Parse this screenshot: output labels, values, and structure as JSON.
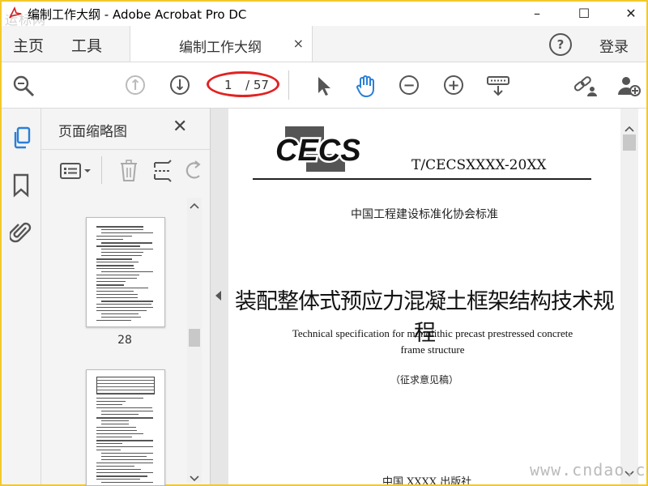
{
  "window": {
    "title": "编制工作大纲 - Adobe Acrobat Pro DC",
    "watermark": "运标网",
    "min_label": "–",
    "max_label": "☐",
    "close_label": "✕"
  },
  "menubar": {
    "home": "主页",
    "tools": "工具",
    "doc_tab": "编制工作大纲",
    "tab_close": "×",
    "help": "?",
    "login": "登录"
  },
  "toolbar": {
    "page_current": "1",
    "page_total": "/ 57",
    "prev_page_symbol": "↑",
    "next_page_symbol": "↓",
    "zoom_out_symbol": "−",
    "zoom_in_symbol": "+"
  },
  "panel": {
    "title": "页面缩略图",
    "close": "✕",
    "thumbnails": [
      {
        "page_label": "28"
      },
      {
        "page_label": ""
      }
    ]
  },
  "document": {
    "logo_text": "CECS",
    "standard_no": "T/CECSXXXX-20XX",
    "association": "中国工程建设标准化协会标准",
    "title_cn": "装配整体式预应力混凝土框架结构技术规程",
    "title_en_line1": "Technical specification for monolithic precast prestressed concrete",
    "title_en_line2": "frame structure",
    "draft_note": "（征求意见稿）",
    "publisher": "中国 XXXX 出版社"
  },
  "footer_watermark": "www.cndao.com",
  "colors": {
    "frame": "#f2c92b",
    "accent_blue": "#2a7fd8",
    "annotation_red": "#e12222"
  }
}
